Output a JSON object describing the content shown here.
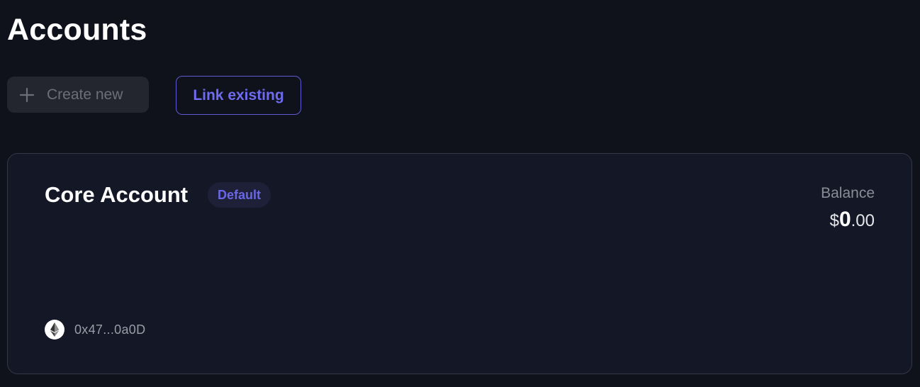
{
  "page": {
    "title": "Accounts"
  },
  "actions": {
    "create_label": "Create new",
    "create_icon": "plus-icon",
    "link_label": "Link existing"
  },
  "account": {
    "name": "Core Account",
    "badge": "Default",
    "balance_label": "Balance",
    "balance_currency": "$",
    "balance_whole": "0",
    "balance_fraction": ".00",
    "network_icon": "ethereum-icon",
    "address": "0x47...0a0D"
  },
  "colors": {
    "background": "#0f111b",
    "card": "#141726",
    "accent": "#6f6cf0",
    "muted_text": "#8a8c96"
  }
}
